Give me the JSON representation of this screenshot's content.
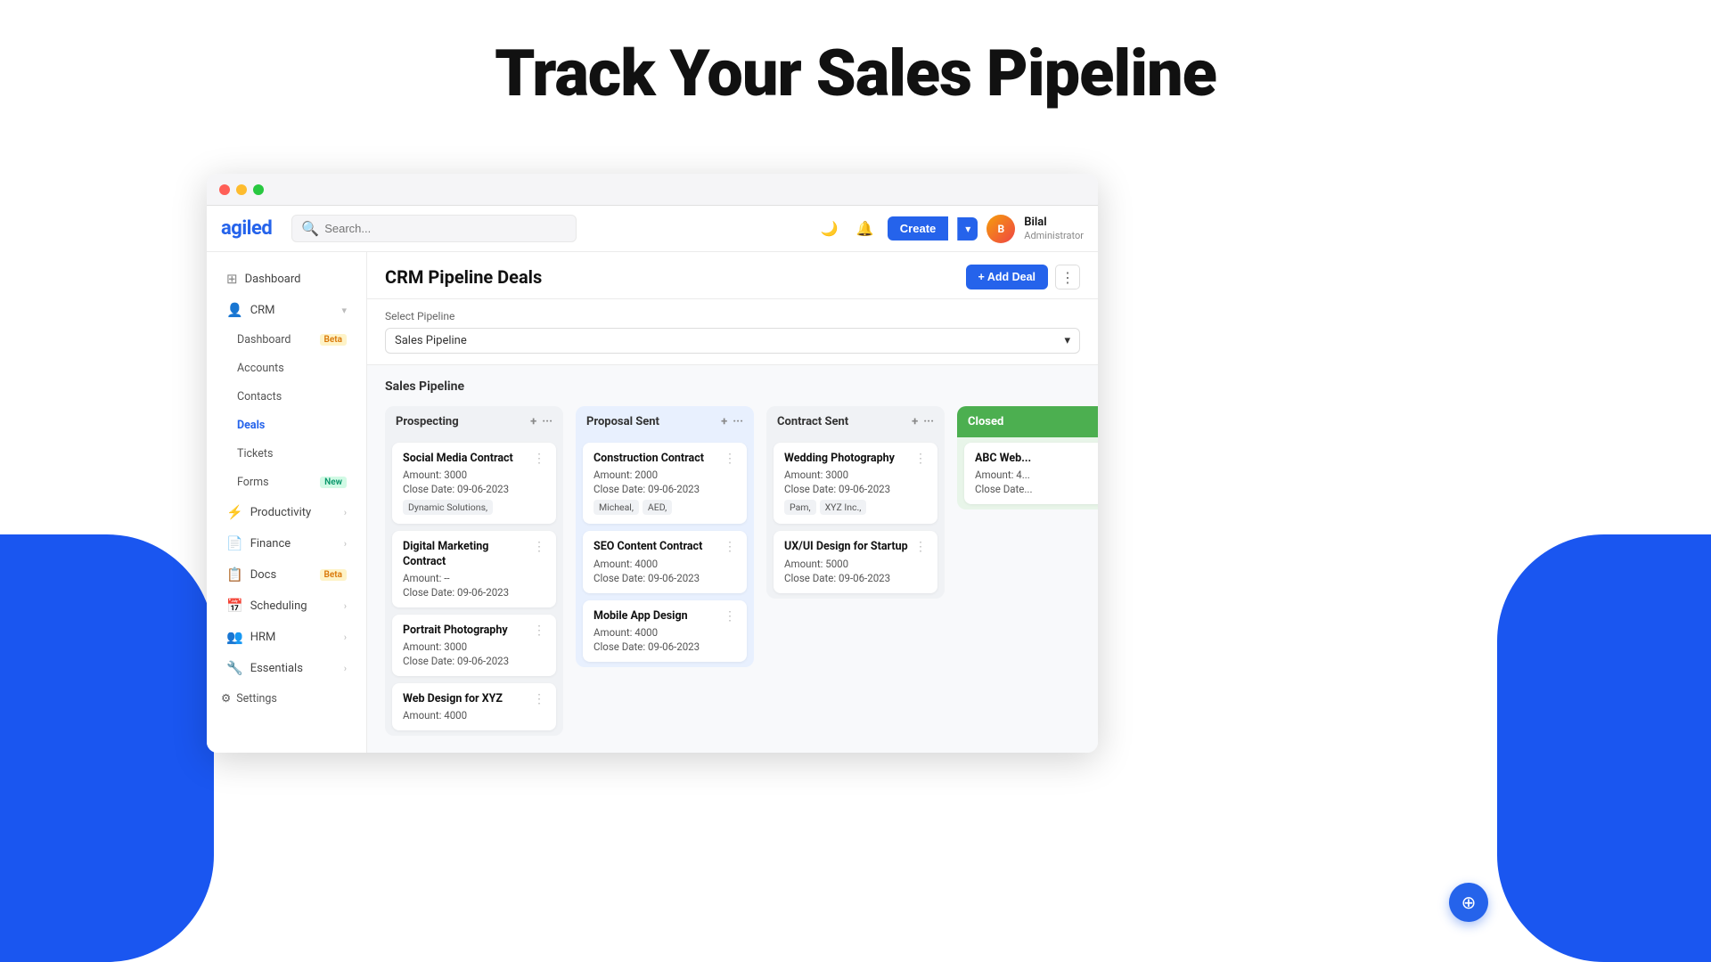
{
  "hero": {
    "title": "Track Your Sales Pipeline"
  },
  "window": {
    "dots": [
      "red",
      "yellow",
      "green"
    ]
  },
  "header": {
    "logo": "agiled",
    "search_placeholder": "Search...",
    "create_label": "Create",
    "user_name": "Bilal",
    "user_role": "Administrator",
    "moon_icon": "🌙",
    "bell_icon": "🔔"
  },
  "sidebar": {
    "items": [
      {
        "label": "Dashboard",
        "icon": "⊞",
        "badge": null,
        "sub": false
      },
      {
        "label": "CRM",
        "icon": "👤",
        "badge": null,
        "sub": false,
        "has_arrow": true
      },
      {
        "label": "Dashboard",
        "icon": null,
        "badge": "Beta",
        "badge_type": "beta",
        "sub": true
      },
      {
        "label": "Accounts",
        "icon": null,
        "badge": null,
        "sub": true
      },
      {
        "label": "Contacts",
        "icon": null,
        "badge": null,
        "sub": true
      },
      {
        "label": "Deals",
        "icon": null,
        "badge": null,
        "sub": true,
        "active": true
      },
      {
        "label": "Tickets",
        "icon": null,
        "badge": null,
        "sub": true
      },
      {
        "label": "Forms",
        "icon": null,
        "badge": "New",
        "badge_type": "new",
        "sub": true
      },
      {
        "label": "Productivity",
        "icon": "⚡",
        "badge": null,
        "sub": false,
        "has_arrow": true
      },
      {
        "label": "Finance",
        "icon": "📄",
        "badge": null,
        "sub": false,
        "has_arrow": true
      },
      {
        "label": "Docs",
        "icon": "📋",
        "badge": "Beta",
        "badge_type": "beta",
        "sub": false,
        "has_arrow": false
      },
      {
        "label": "Scheduling",
        "icon": "📅",
        "badge": null,
        "sub": false,
        "has_arrow": true
      },
      {
        "label": "HRM",
        "icon": "👥",
        "badge": null,
        "sub": false,
        "has_arrow": true
      },
      {
        "label": "Essentials",
        "icon": "🔧",
        "badge": null,
        "sub": false,
        "has_arrow": true
      }
    ],
    "settings_label": "⚙ Settings"
  },
  "page": {
    "title": "CRM Pipeline Deals",
    "add_deal_label": "+ Add Deal",
    "select_pipeline_label": "Select Pipeline",
    "pipeline_value": "Sales Pipeline",
    "kanban_title": "Sales Pipeline"
  },
  "columns": [
    {
      "id": "prospecting",
      "title": "Prospecting",
      "color": "default",
      "cards": [
        {
          "title": "Social Media Contract",
          "amount": "Amount: 3000",
          "date": "Close Date: 09-06-2023",
          "tags": [
            "Dynamic Solutions,"
          ]
        },
        {
          "title": "Digital Marketing Contract",
          "amount": "Amount: --",
          "date": "Close Date: 09-06-2023",
          "tags": []
        },
        {
          "title": "Portrait Photography",
          "amount": "Amount: 3000",
          "date": "Close Date: 09-06-2023",
          "tags": []
        },
        {
          "title": "Web Design for XYZ",
          "amount": "Amount: 4000",
          "date": "",
          "tags": []
        }
      ]
    },
    {
      "id": "proposal-sent",
      "title": "Proposal Sent",
      "color": "blue",
      "cards": [
        {
          "title": "Construction Contract",
          "amount": "Amount: 2000",
          "date": "Close Date: 09-06-2023",
          "tags": [
            "Micheal,",
            "AED,"
          ]
        },
        {
          "title": "SEO Content Contract",
          "amount": "Amount: 4000",
          "date": "Close Date: 09-06-2023",
          "tags": []
        },
        {
          "title": "Mobile App Design",
          "amount": "Amount: 4000",
          "date": "Close Date: 09-06-2023",
          "tags": []
        }
      ]
    },
    {
      "id": "contract-sent",
      "title": "Contract Sent",
      "color": "default",
      "cards": [
        {
          "title": "Wedding Photography",
          "amount": "Amount: 3000",
          "date": "Close Date: 09-06-2023",
          "tags": [
            "Pam,",
            "XYZ Inc.,"
          ]
        },
        {
          "title": "UX/UI Design for Startup",
          "amount": "Amount: 5000",
          "date": "Close Date: 09-06-2023",
          "tags": []
        }
      ]
    },
    {
      "id": "closed",
      "title": "Closed",
      "color": "green",
      "cards": [
        {
          "title": "ABC Web...",
          "amount": "Amount: 4...",
          "date": "Close Date...",
          "tags": []
        }
      ]
    }
  ]
}
